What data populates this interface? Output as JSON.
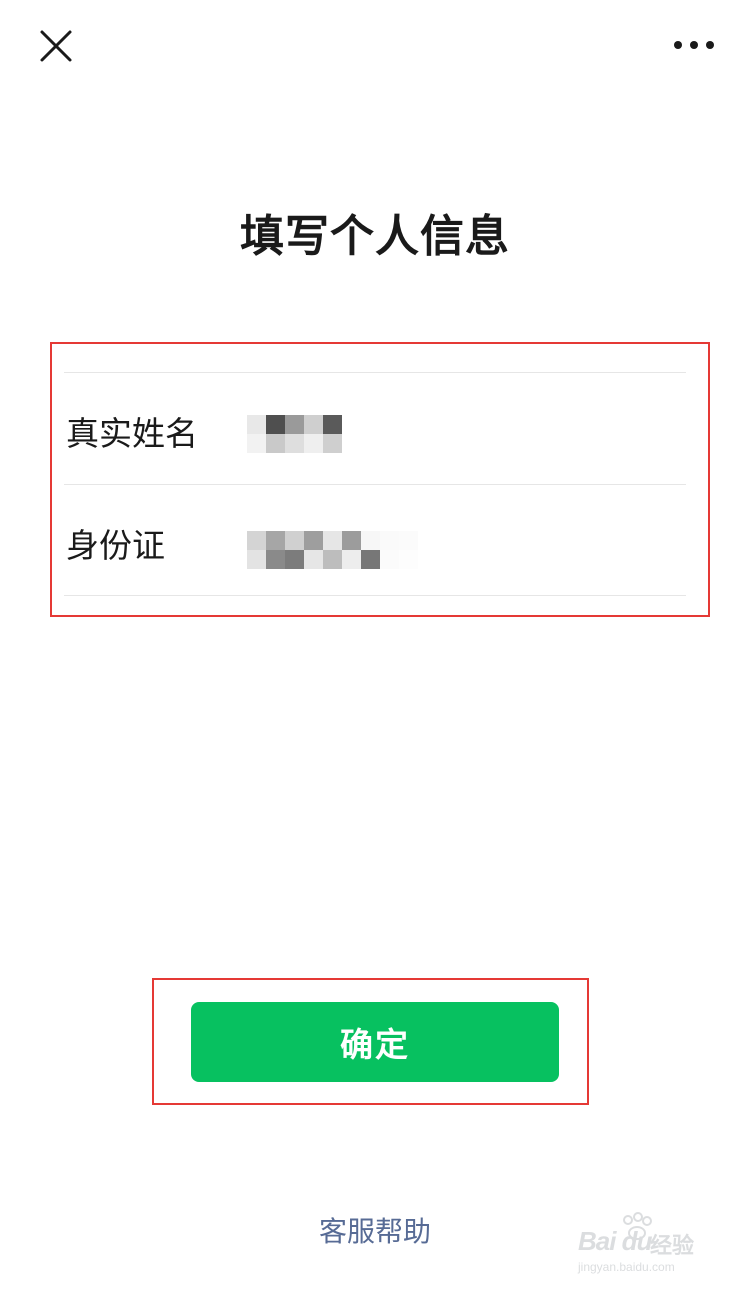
{
  "topbar": {
    "close_icon": "close-icon",
    "more_icon": "more-dots-icon"
  },
  "page": {
    "title": "填写个人信息"
  },
  "form": {
    "fields": [
      {
        "label": "真实姓名",
        "value_state": "pixelated"
      },
      {
        "label": "身份证",
        "value_state": "pixelated"
      }
    ]
  },
  "actions": {
    "confirm_label": "确定",
    "confirm_color": "#07c160",
    "help_label": "客服帮助",
    "help_color": "#576b95"
  },
  "annotations": {
    "highlight_color": "#e53935"
  },
  "watermark": {
    "logo_text": "Bai du",
    "logo_suffix": "经验",
    "url": "jingyan.baidu.com"
  }
}
